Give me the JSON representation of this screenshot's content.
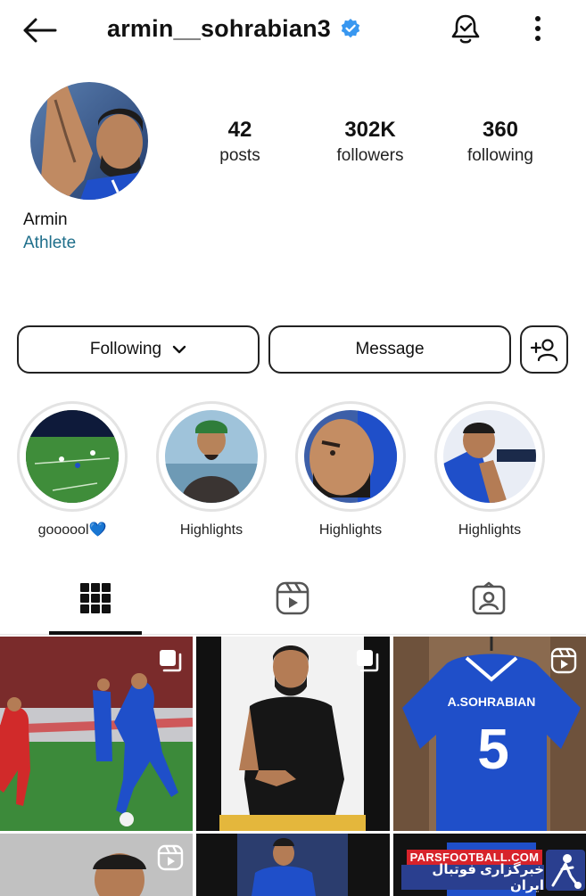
{
  "header": {
    "username": "armin__sohrabian3",
    "icons": {
      "back": "arrow-left-icon",
      "verified": "verified-badge-icon",
      "notifications": "bell-check-icon",
      "more": "more-vertical-icon"
    }
  },
  "profile": {
    "name": "Armin",
    "category": "Athlete",
    "stats": {
      "posts": {
        "value": "42",
        "label": "posts"
      },
      "followers": {
        "value": "302K",
        "label": "followers"
      },
      "following": {
        "value": "360",
        "label": "following"
      }
    }
  },
  "actions": {
    "following_label": "Following",
    "message_label": "Message",
    "icons": {
      "following": "chevron-down-icon",
      "add_user": "add-user-icon"
    }
  },
  "highlights": [
    {
      "label": "goooool💙"
    },
    {
      "label": "Highlights"
    },
    {
      "label": "Highlights"
    },
    {
      "label": "Highlights"
    }
  ],
  "tabs": [
    {
      "name": "posts-grid",
      "icon": "grid-icon",
      "active": true
    },
    {
      "name": "reels",
      "icon": "reels-icon",
      "active": false
    },
    {
      "name": "tagged",
      "icon": "tagged-person-icon",
      "active": false
    }
  ],
  "grid": {
    "tiles": [
      {
        "type": "carousel",
        "jersey_name": ""
      },
      {
        "type": "carousel",
        "jersey_name": ""
      },
      {
        "type": "reel",
        "jersey_name": "A.SOHRABIAN",
        "jersey_number": "5"
      },
      {
        "type": "reel"
      },
      {
        "type": "image"
      },
      {
        "type": "image"
      }
    ]
  },
  "watermark": {
    "site": "PARSFOOTBALL.COM",
    "tagline": "خبرگزاری فوتبال ایران"
  },
  "colors": {
    "link": "#1f6f8b",
    "verified": "#3897f0",
    "team_blue": "#1f4fc9",
    "opponent_red": "#d12a2a"
  }
}
